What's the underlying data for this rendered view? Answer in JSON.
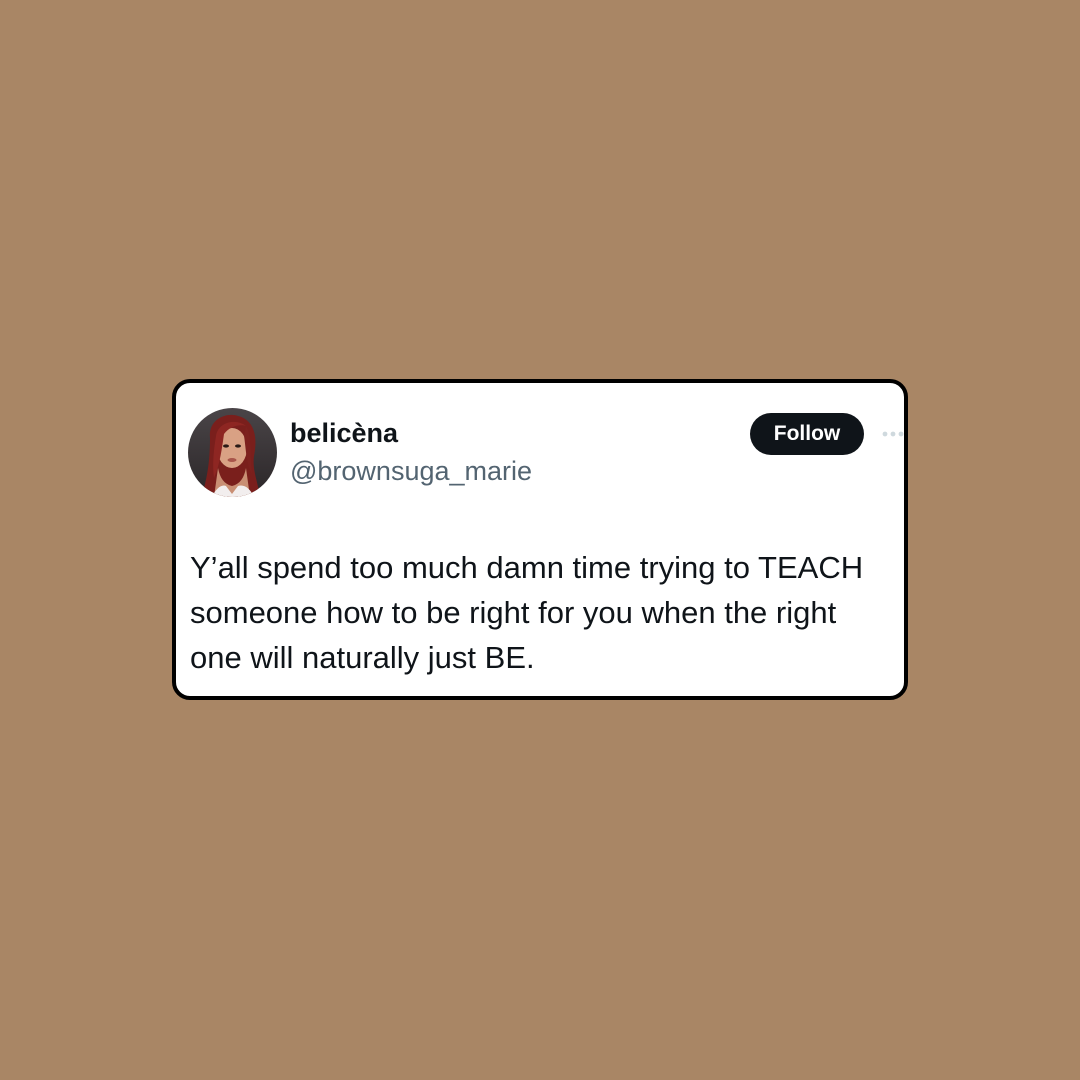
{
  "colors": {
    "background": "#a98665",
    "card_background": "#ffffff",
    "card_border": "#000000",
    "name_text": "#0f1419",
    "handle_text": "#536471",
    "body_text": "#0f1419",
    "follow_button_bg": "#0f1419",
    "follow_button_text": "#ffffff",
    "more_icon": "#cfd9de"
  },
  "tweet": {
    "author": {
      "avatar_icon": "profile-photo-avatar",
      "display_name": "belicèna",
      "handle": "@brownsuga_marie"
    },
    "follow_label": "Follow",
    "more_icon": "more-dots-icon",
    "text": "Y’all spend too much damn time trying to TEACH someone how to be right for you when the right one will naturally just BE."
  }
}
